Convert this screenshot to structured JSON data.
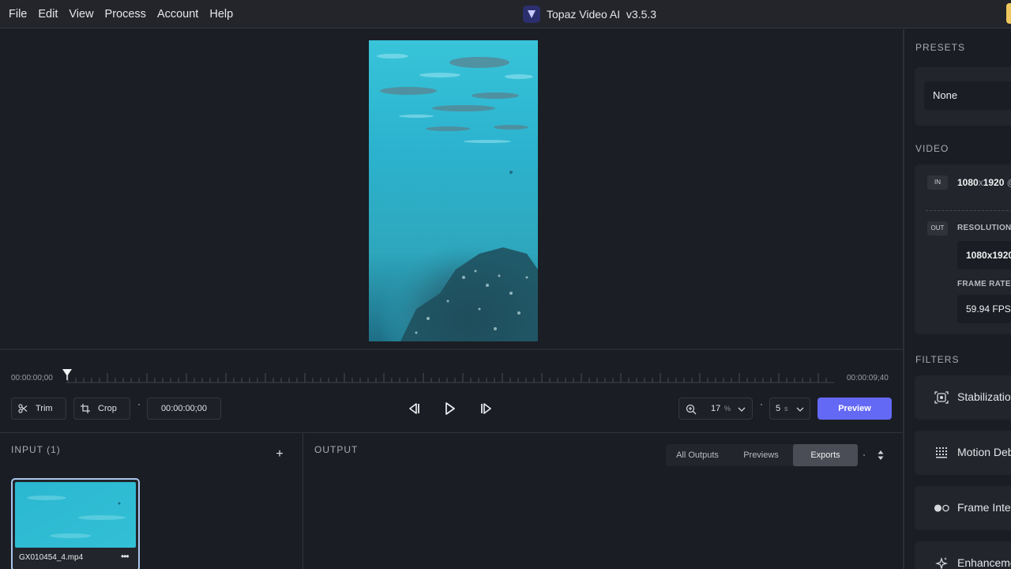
{
  "menubar": {
    "items": [
      "File",
      "Edit",
      "View",
      "Process",
      "Account",
      "Help"
    ],
    "title": "Topaz Video AI  v3.5.3"
  },
  "timeline": {
    "start_time": "00:00:00;00",
    "end_time": "00:00:09;40"
  },
  "controls": {
    "trim_label": "Trim",
    "crop_label": "Crop",
    "timecode": "00:00:00;00",
    "zoom_value": "17",
    "zoom_unit": "%",
    "length_value": "5",
    "length_unit": "s",
    "preview_label": "Preview"
  },
  "input_panel": {
    "title": "INPUT (1)",
    "add_label": "+",
    "files": [
      {
        "name": "GX010454_4.mp4",
        "more": "•••"
      }
    ]
  },
  "output_panel": {
    "title": "OUTPUT",
    "tabs": [
      "All Outputs",
      "Previews",
      "Exports"
    ],
    "active_tab": "Exports"
  },
  "sidebar": {
    "presets_heading": "PRESETS",
    "preset_value": "None",
    "video_heading": "VIDEO",
    "in_tag": "IN",
    "in_width": "1080",
    "in_x": "x",
    "in_height": "1920",
    "in_suffix": "@",
    "out_tag": "OUT",
    "resolution_label": "RESOLUTION",
    "resolution_value": "1080x1920",
    "framerate_label": "FRAME RATE",
    "framerate_value": "59.94 FPS",
    "filters_heading": "FILTERS",
    "filters": [
      {
        "label": "Stabilization",
        "icon": "stabilization-icon"
      },
      {
        "label": "Motion Deblur",
        "icon": "motion-deblur-icon"
      },
      {
        "label": "Frame Interpolation",
        "icon": "frame-interpolation-icon"
      },
      {
        "label": "Enhancement",
        "icon": "enhancement-icon"
      }
    ]
  },
  "colors": {
    "accent": "#6469f5",
    "background": "#1a1d23",
    "panel": "#22252b",
    "water": "#2fb6cf"
  }
}
